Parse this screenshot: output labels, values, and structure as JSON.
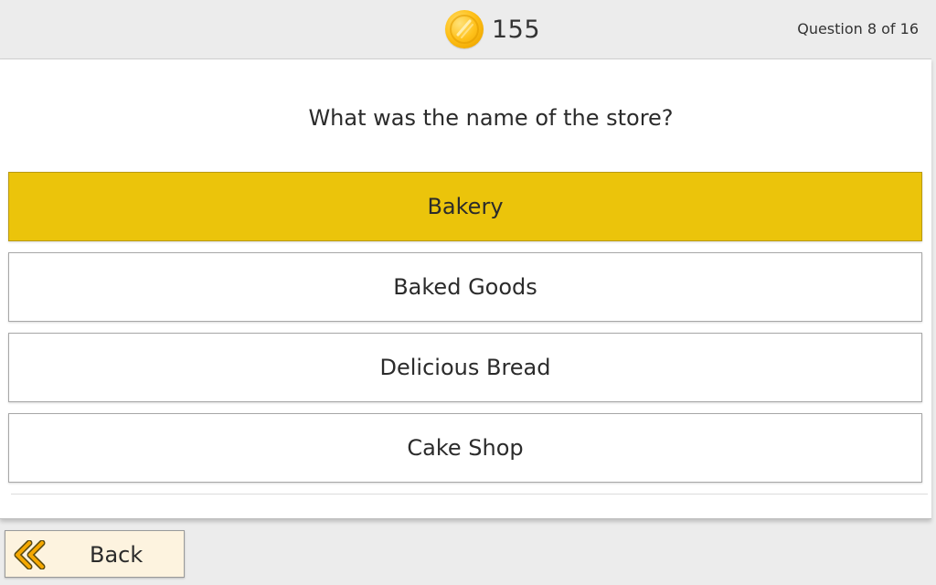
{
  "header": {
    "coin_count": "155",
    "coin_icon": "gold-coin-icon",
    "progress_text": "Question 8 of 16"
  },
  "quiz": {
    "question": "What was the name of the store?",
    "answers": [
      {
        "label": "Bakery",
        "selected": true
      },
      {
        "label": "Baked Goods",
        "selected": false
      },
      {
        "label": "Delicious Bread",
        "selected": false
      },
      {
        "label": "Cake Shop",
        "selected": false
      }
    ],
    "selected_color": "#ebc40b"
  },
  "footer": {
    "back_label": "Back",
    "back_icon": "double-chevron-left-icon",
    "back_icon_color": "#f5a800"
  }
}
